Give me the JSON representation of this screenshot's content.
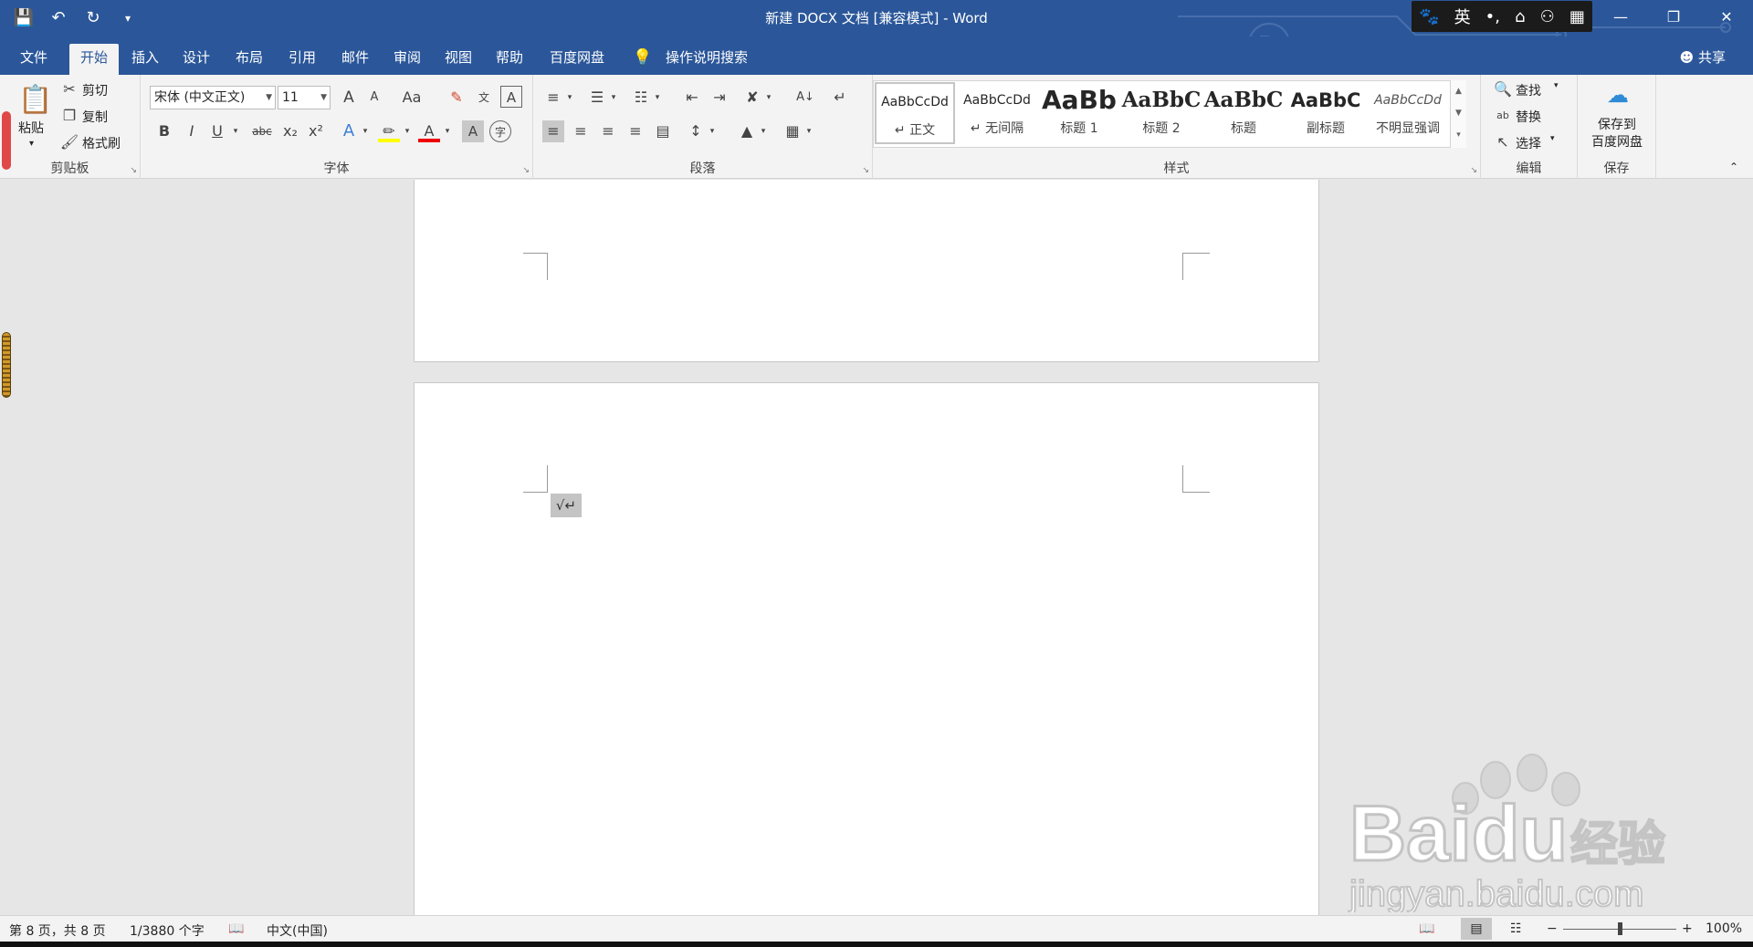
{
  "app": {
    "title": "新建 DOCX 文档 [兼容模式] - Word",
    "share_label": "共享"
  },
  "qat": {
    "save": "save-icon",
    "undo": "undo-icon",
    "redo": "redo-icon",
    "customize": "customize-icon"
  },
  "ime": {
    "paw": "🐾",
    "lang": "英",
    "punct": "•,",
    "tool": "⌂",
    "user": "⚇",
    "grid": "▦"
  },
  "tabs": [
    {
      "label": "文件"
    },
    {
      "label": "开始"
    },
    {
      "label": "插入"
    },
    {
      "label": "设计"
    },
    {
      "label": "布局"
    },
    {
      "label": "引用"
    },
    {
      "label": "邮件"
    },
    {
      "label": "审阅"
    },
    {
      "label": "视图"
    },
    {
      "label": "帮助"
    },
    {
      "label": "百度网盘"
    },
    {
      "label": "操作说明搜索"
    }
  ],
  "ribbon": {
    "clipboard": {
      "paste": "粘贴",
      "cut": "剪切",
      "copy": "复制",
      "format_painter": "格式刷",
      "label": "剪贴板"
    },
    "font": {
      "name": "宋体 (中文正文)",
      "size": "11",
      "label": "字体",
      "bold": "B",
      "italic": "I",
      "underline": "U",
      "strike": "abc",
      "sub": "x₂",
      "sup": "x²",
      "aa": "Aa",
      "grow": "A",
      "shrink": "A"
    },
    "paragraph": {
      "label": "段落"
    },
    "styles": {
      "label": "样式",
      "items": [
        {
          "preview": "AaBbCcDd",
          "label": "↵ 正文"
        },
        {
          "preview": "AaBbCcDd",
          "label": "↵ 无间隔"
        },
        {
          "preview": "AaBb",
          "label": "标题 1"
        },
        {
          "preview": "AaBbC",
          "label": "标题 2"
        },
        {
          "preview": "AaBbC",
          "label": "标题"
        },
        {
          "preview": "AaBbC",
          "label": "副标题"
        },
        {
          "preview": "AaBbCcDd",
          "label": "不明显强调"
        }
      ]
    },
    "editing": {
      "find": "查找",
      "replace": "替换",
      "select": "选择",
      "label": "编辑"
    },
    "save": {
      "btn": "保存到\n百度网盘",
      "label": "保存"
    }
  },
  "document": {
    "paragraph_mark": "√↵"
  },
  "status": {
    "page": "第 8 页，共 8 页",
    "words": "1/3880 个字",
    "lang": "中文(中国)",
    "zoom": "100%"
  },
  "watermark": {
    "brand": "Baidu",
    "jy": "经验",
    "url": "jingyan.baidu.com"
  }
}
